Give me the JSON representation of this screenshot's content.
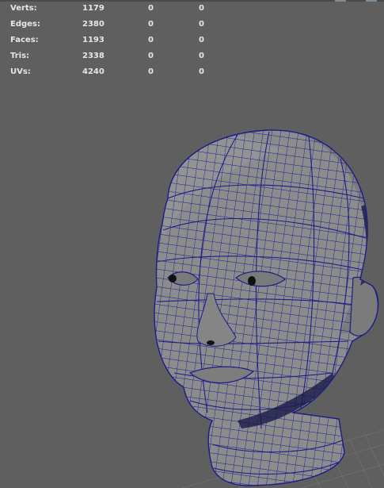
{
  "hud": {
    "rows": [
      {
        "label": "Verts:",
        "total": "1179",
        "selected": "0",
        "components": "0"
      },
      {
        "label": "Edges:",
        "total": "2380",
        "selected": "0",
        "components": "0"
      },
      {
        "label": "Faces:",
        "total": "1193",
        "selected": "0",
        "components": "0"
      },
      {
        "label": "Tris:",
        "total": "2338",
        "selected": "0",
        "components": "0"
      },
      {
        "label": "UVs:",
        "total": "4240",
        "selected": "0",
        "components": "0"
      }
    ]
  },
  "colors": {
    "viewport_bg": "#5f5f5f",
    "mesh_fill": "#8c8c8c",
    "wire": "#1c1c8c",
    "grid": "#707070",
    "hud_text": "#e6e6e6"
  },
  "mesh": {
    "object_icon": "head-mesh-icon"
  }
}
